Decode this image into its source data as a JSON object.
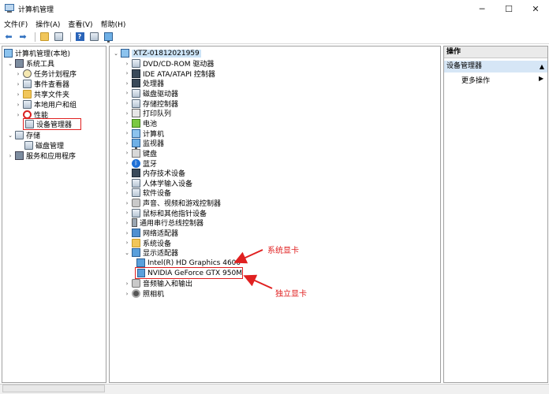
{
  "window": {
    "title": "计算机管理",
    "min_glyph": "─",
    "max_glyph": "☐",
    "close_glyph": "✕"
  },
  "menu": [
    "文件(F)",
    "操作(A)",
    "查看(V)",
    "帮助(H)"
  ],
  "left_tree": {
    "root": "计算机管理(本地)",
    "system_tools": "系统工具",
    "task_scheduler": "任务计划程序",
    "event_viewer": "事件查看器",
    "shared_folders": "共享文件夹",
    "local_users": "本地用户和组",
    "performance": "性能",
    "device_manager": "设备管理器",
    "storage": "存储",
    "disk_management": "磁盘管理",
    "services": "服务和应用程序"
  },
  "device_tree": {
    "computer": "XTZ-01812021959",
    "categories": [
      "DVD/CD-ROM 驱动器",
      "IDE ATA/ATAPI 控制器",
      "处理器",
      "磁盘驱动器",
      "存储控制器",
      "打印队列",
      "电池",
      "计算机",
      "监视器",
      "键盘",
      "蓝牙",
      "内存技术设备",
      "人体学输入设备",
      "软件设备",
      "声音、视频和游戏控制器",
      "鼠标和其他指针设备",
      "通用串行总线控制器",
      "网络适配器",
      "系统设备",
      "显示适配器"
    ],
    "display_children": [
      "Intel(R) HD Graphics 4600",
      "NVIDIA GeForce GTX 950M"
    ],
    "after_display": [
      "音频输入和输出",
      "照相机"
    ]
  },
  "actions": {
    "header": "操作",
    "section": "设备管理器",
    "more": "更多操作"
  },
  "annotations": {
    "integrated": "系统显卡",
    "discrete": "独立显卡"
  },
  "colors": {
    "annotation": "#e02020",
    "selection": "#cce4f7"
  }
}
